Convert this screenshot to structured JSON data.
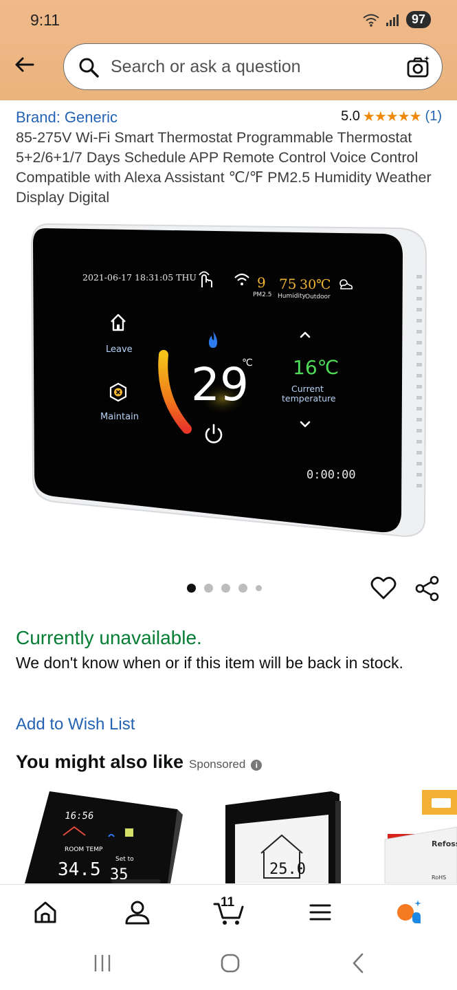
{
  "status": {
    "time": "9:11",
    "battery": "97"
  },
  "search": {
    "placeholder": "Search or ask a question"
  },
  "product": {
    "brand": "Brand: Generic",
    "rating": "5.0",
    "rating_stars": "★★★★★",
    "review_count": "(1)",
    "title": "85-275V Wi-Fi Smart Thermostat Programmable Thermostat 5+2/6+1/7 Days Schedule APP Remote Control Voice Control Compatible with Alexa Assistant ℃/℉ PM2.5 Humidity Weather Display Digital",
    "screen": {
      "datetime": "2021-06-17 18:31:05 THU",
      "pm": "9",
      "pm_label": "PM2.5",
      "humidity": "75",
      "humidity_label": "Humidity",
      "outdoor": "30℃",
      "outdoor_label": "Outdoor",
      "leave": "Leave",
      "maintain": "Maintain",
      "setpoint": "29",
      "unit": "℃",
      "current": "16℃",
      "current_label_1": "Current",
      "current_label_2": "temperature",
      "timer": "0:00:00"
    }
  },
  "availability": {
    "status": "Currently unavailable.",
    "note": "We don't know when or if this item will be back in stock."
  },
  "wishlist_label": "Add to Wish List",
  "recommendations": {
    "heading": "You might also like",
    "sponsored": "Sponsored",
    "info_icon": "i",
    "items": [
      {
        "time": "16:56",
        "label": "ROOM TEMP",
        "temp": "34.5",
        "set_label": "Set to",
        "set_temp": "35"
      },
      {
        "temp": "25.0"
      },
      {
        "brand": "Refoss",
        "tag": "RoHS"
      }
    ]
  },
  "bottom_nav": {
    "cart_count": "11"
  },
  "colors": {
    "header": "#eab47e",
    "link": "#2463b4",
    "available_green": "#067d35",
    "star": "#f08804"
  }
}
